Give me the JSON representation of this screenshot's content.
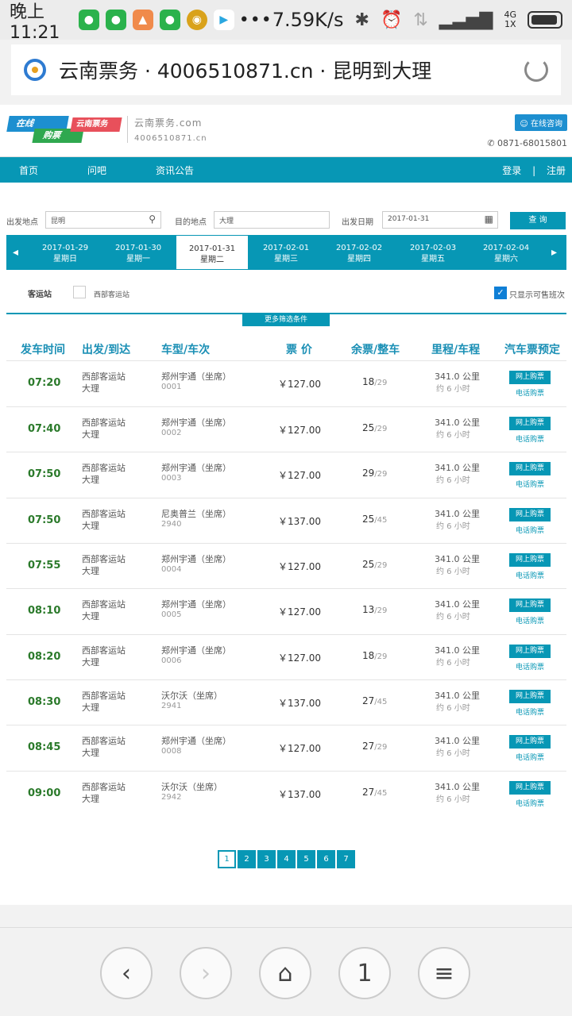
{
  "status": {
    "time": "晚上11:21",
    "speed": "7.59K/s",
    "network": "4G\n1X",
    "more": "•••"
  },
  "url": {
    "text": "云南票务 · 4006510871.cn · 昆明到大理"
  },
  "header": {
    "logo_zaixian": "在线",
    "logo_goupiao": "购票",
    "logo_brand": "云南票务",
    "site_name": "云南票务.com",
    "site_phone": "4006510871.cn",
    "consult": "在线咨询",
    "hotline": "0871-68015801"
  },
  "nav": {
    "items": [
      "首页",
      "问吧",
      "资讯公告"
    ],
    "login": "登录",
    "sep": "|",
    "register": "注册"
  },
  "search": {
    "from_label": "出发地点",
    "from_value": "昆明",
    "to_label": "目的地点",
    "to_value": "大理",
    "date_label": "出发日期",
    "date_value": "2017-01-31",
    "query": "查 询"
  },
  "dates": [
    {
      "date": "2017-01-29",
      "week": "星期日"
    },
    {
      "date": "2017-01-30",
      "week": "星期一"
    },
    {
      "date": "2017-01-31",
      "week": "星期二"
    },
    {
      "date": "2017-02-01",
      "week": "星期三"
    },
    {
      "date": "2017-02-02",
      "week": "星期四"
    },
    {
      "date": "2017-02-03",
      "week": "星期五"
    },
    {
      "date": "2017-02-04",
      "week": "星期六"
    }
  ],
  "filter": {
    "station_label": "客运站",
    "station_option": "西部客运站",
    "only_available": "只显示可售班次",
    "more": "更多筛选条件"
  },
  "table": {
    "headers": [
      "发车时间",
      "出发/到达",
      "车型/车次",
      "票 价",
      "余票/整车",
      "里程/车程",
      "汽车票预定"
    ]
  },
  "rows": [
    {
      "time": "07:20",
      "from": "西部客运站",
      "to": "大理",
      "model": "郑州宇通（坐席）",
      "no": "0001",
      "price": "￥127.00",
      "left": "18",
      "total": "/29",
      "dist": "341.0 公里",
      "dur": "约 6 小时",
      "buy": "网上购票",
      "phone": "电话购票"
    },
    {
      "time": "07:40",
      "from": "西部客运站",
      "to": "大理",
      "model": "郑州宇通（坐席）",
      "no": "0002",
      "price": "￥127.00",
      "left": "25",
      "total": "/29",
      "dist": "341.0 公里",
      "dur": "约 6 小时",
      "buy": "网上购票",
      "phone": "电话购票"
    },
    {
      "time": "07:50",
      "from": "西部客运站",
      "to": "大理",
      "model": "郑州宇通（坐席）",
      "no": "0003",
      "price": "￥127.00",
      "left": "29",
      "total": "/29",
      "dist": "341.0 公里",
      "dur": "约 6 小时",
      "buy": "网上购票",
      "phone": "电话购票"
    },
    {
      "time": "07:50",
      "from": "西部客运站",
      "to": "大理",
      "model": "尼奥普兰（坐席）",
      "no": "2940",
      "price": "￥137.00",
      "left": "25",
      "total": "/45",
      "dist": "341.0 公里",
      "dur": "约 6 小时",
      "buy": "网上购票",
      "phone": "电话购票"
    },
    {
      "time": "07:55",
      "from": "西部客运站",
      "to": "大理",
      "model": "郑州宇通（坐席）",
      "no": "0004",
      "price": "￥127.00",
      "left": "25",
      "total": "/29",
      "dist": "341.0 公里",
      "dur": "约 6 小时",
      "buy": "网上购票",
      "phone": "电话购票"
    },
    {
      "time": "08:10",
      "from": "西部客运站",
      "to": "大理",
      "model": "郑州宇通（坐席）",
      "no": "0005",
      "price": "￥127.00",
      "left": "13",
      "total": "/29",
      "dist": "341.0 公里",
      "dur": "约 6 小时",
      "buy": "网上购票",
      "phone": "电话购票"
    },
    {
      "time": "08:20",
      "from": "西部客运站",
      "to": "大理",
      "model": "郑州宇通（坐席）",
      "no": "0006",
      "price": "￥127.00",
      "left": "18",
      "total": "/29",
      "dist": "341.0 公里",
      "dur": "约 6 小时",
      "buy": "网上购票",
      "phone": "电话购票"
    },
    {
      "time": "08:30",
      "from": "西部客运站",
      "to": "大理",
      "model": "沃尔沃（坐席）",
      "no": "2941",
      "price": "￥137.00",
      "left": "27",
      "total": "/45",
      "dist": "341.0 公里",
      "dur": "约 6 小时",
      "buy": "网上购票",
      "phone": "电话购票"
    },
    {
      "time": "08:45",
      "from": "西部客运站",
      "to": "大理",
      "model": "郑州宇通（坐席）",
      "no": "0008",
      "price": "￥127.00",
      "left": "27",
      "total": "/29",
      "dist": "341.0 公里",
      "dur": "约 6 小时",
      "buy": "网上购票",
      "phone": "电话购票"
    },
    {
      "time": "09:00",
      "from": "西部客运站",
      "to": "大理",
      "model": "沃尔沃（坐席）",
      "no": "2942",
      "price": "￥137.00",
      "left": "27",
      "total": "/45",
      "dist": "341.0 公里",
      "dur": "约 6 小时",
      "buy": "网上购票",
      "phone": "电话购票"
    }
  ],
  "pager": [
    "1",
    "2",
    "3",
    "4",
    "5",
    "6",
    "7"
  ],
  "browser": {
    "tabs_count": "1"
  }
}
